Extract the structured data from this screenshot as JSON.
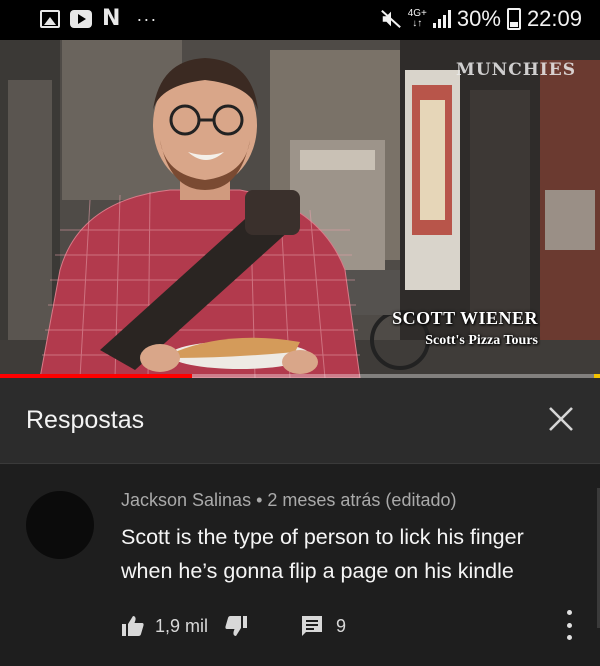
{
  "status_bar": {
    "icons_left": [
      "gallery-icon",
      "youtube-icon",
      "n-notification-icon",
      "more-notifications-icon"
    ],
    "n_label": "N",
    "more_label": "···",
    "network_label": "4G+",
    "network_sub": "↓↑",
    "battery_percent": "30%",
    "time": "22:09"
  },
  "video": {
    "channel_watermark": "MUNCHIES",
    "lower_third_name": "SCOTT WIENER",
    "lower_third_subtitle": "Scott's Pizza Tours",
    "progress_fraction": 0.32,
    "colors": {
      "progress": "#ff0000",
      "shirt": "#b23a4d"
    }
  },
  "replies_panel": {
    "title": "Respostas",
    "close_icon": "close-icon"
  },
  "comment": {
    "author": "Jackson Salinas",
    "separator": "•",
    "timestamp": "2 meses atrás (editado)",
    "text": "Scott is the type of person to lick his finger when he’s gonna flip a page on his kindle",
    "like_count": "1,9 mil",
    "reply_count": "9",
    "icons": [
      "thumbs-up-icon",
      "thumbs-down-icon",
      "reply-icon",
      "more-vert-icon"
    ]
  }
}
